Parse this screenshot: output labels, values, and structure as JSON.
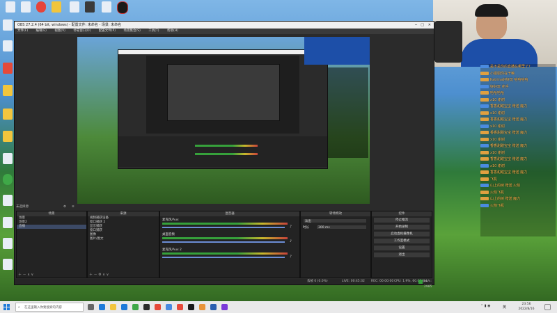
{
  "desktop": {
    "top_icons": [
      "Firefox",
      "音乐",
      "NetEase",
      "Movie",
      "OBS",
      "新建",
      "",
      "",
      ""
    ],
    "left_labels": [
      "Fiddle",
      "",
      "",
      "",
      "",
      "",
      "",
      "",
      ""
    ]
  },
  "obs": {
    "title": "OBS 27.2.4 (64 bit, windows) - 配置文件: 未命名 - 场景: 未命名",
    "menu": [
      "文件(F)",
      "编辑(E)",
      "视图(V)",
      "停靠窗口(D)",
      "配置文件(P)",
      "场景集合(S)",
      "工具(T)",
      "帮助(H)"
    ],
    "notice": "未选择源",
    "scenes": {
      "header": "场景",
      "items": [
        "场景",
        "场景2",
        "直播"
      ],
      "selected_index": 2
    },
    "sources": {
      "header": "来源",
      "items": [
        "视频捕获设备",
        "窗口捕获 2",
        "显示捕获",
        "窗口捕获",
        "图像",
        "图片/图文"
      ]
    },
    "mixer": {
      "header": "混音器",
      "channels": [
        "麦克风/Aux",
        "桌面音频",
        "麦克风/Aux 2"
      ]
    },
    "transitions": {
      "header": "转场特效",
      "type": "淡出",
      "duration_label": "时长",
      "duration": "300 ms"
    },
    "controls": {
      "header": "控件",
      "buttons": [
        "停止推流",
        "开始录制",
        "启动虚拟摄像机",
        "工作室模式",
        "设置",
        "退出"
      ]
    },
    "status": {
      "dropped": "丢帧 0 (0.0%)",
      "live": "LIVE: 00:45:32",
      "rec": "REC: 00:00:00",
      "cpu": "CPU: 1.9%, 60.00 fps",
      "kbps": "kb/s: 2985"
    }
  },
  "chat": {
    "lines": [
      {
        "user": "",
        "msg": "是不是你的直播在哪里了？"
      },
      {
        "user": "",
        "msg": "小姐姐你在干嘛"
      },
      {
        "user": "",
        "msg": "Katrina好好玩  哈哈哈哈"
      },
      {
        "user": "",
        "msg": "好好玩  花手"
      },
      {
        "user": "",
        "msg": "哈哈哈哈"
      },
      {
        "user": "",
        "msg": "x10 谢谢"
      },
      {
        "user": "",
        "msg": "香香甜甜宝宝 赠送 魔力"
      },
      {
        "user": "",
        "msg": "x10 谢谢"
      },
      {
        "user": "",
        "msg": "香香甜甜宝宝 赠送 魔力"
      },
      {
        "user": "",
        "msg": "x10 谢谢"
      },
      {
        "user": "",
        "msg": "香香甜甜宝宝 赠送 魔力"
      },
      {
        "user": "",
        "msg": "x10 谢谢"
      },
      {
        "user": "",
        "msg": "香香甜甜宝宝 赠送 魔力"
      },
      {
        "user": "",
        "msg": "x10 谢谢"
      },
      {
        "user": "",
        "msg": "香香甜甜宝宝 赠送 魔力"
      },
      {
        "user": "",
        "msg": "x10 谢谢"
      },
      {
        "user": "",
        "msg": "香香甜甜宝宝 赠送 魔力"
      },
      {
        "user": "",
        "msg": "飞机"
      },
      {
        "user": "",
        "msg": "山上的树  赠送  火箭"
      },
      {
        "user": "",
        "msg": "火箭飞机"
      },
      {
        "user": "",
        "msg": "山上的树  赠送  魔力"
      },
      {
        "user": "",
        "msg": "火箭飞机"
      }
    ]
  },
  "taskbar": {
    "search_placeholder": "在这里输入你要搜索的内容",
    "time": "23:56",
    "date": "2022/8/16",
    "lang": "英"
  },
  "colors": {
    "accent": "#6d8ed6",
    "meter_green": "#36a13b",
    "chat_text": "#ffb64d"
  }
}
